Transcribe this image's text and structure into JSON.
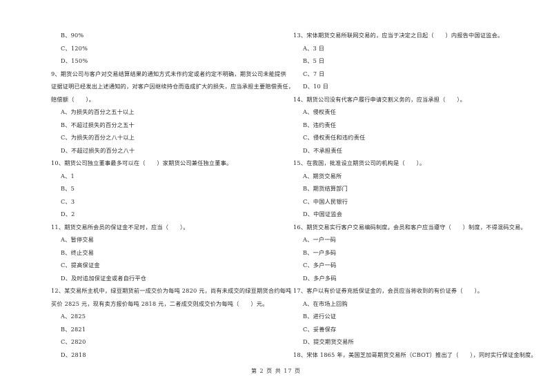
{
  "left_column": [
    {
      "type": "option",
      "text": "B、90%"
    },
    {
      "type": "option",
      "text": "C、120%"
    },
    {
      "type": "option",
      "text": "D、150%"
    },
    {
      "type": "question",
      "text": "9、期货公司与客户对交易结算结果的通知方式未作约定或者约定不明确，期货公司未能提供"
    },
    {
      "type": "question",
      "text": "证据证明已经发出上述通知的，对客户因继续持仓而造成扩大的损失，应当承担主要赔偿责任，"
    },
    {
      "type": "question",
      "text": "赔偿额（　　）。"
    },
    {
      "type": "option",
      "text": "A、为损失的百分之五十以上"
    },
    {
      "type": "option",
      "text": "B、不超过损失的百分之五十"
    },
    {
      "type": "option",
      "text": "C、为损失的百分之八十以上"
    },
    {
      "type": "option",
      "text": "D、不超过损失的百分之八十"
    },
    {
      "type": "question",
      "text": "10、期货公司独立董事最多可以在（　　）家期货公司兼任独立董事。"
    },
    {
      "type": "option",
      "text": "A、1"
    },
    {
      "type": "option",
      "text": "B、5"
    },
    {
      "type": "option",
      "text": "C、3"
    },
    {
      "type": "option",
      "text": "D、2"
    },
    {
      "type": "question",
      "text": "11、期货交易所会员的保证金不足时，应当（　　）。"
    },
    {
      "type": "option",
      "text": "A、暂停交易"
    },
    {
      "type": "option",
      "text": "B、终止交易"
    },
    {
      "type": "option",
      "text": "C、提高保证金"
    },
    {
      "type": "option",
      "text": "D、及时追加保证金或者自行平仓"
    },
    {
      "type": "question",
      "text": "12、某交易所主机中，绿豆期货前一成交价为每吨 2820 元，尚有未成交的绿豆期货合约每吨"
    },
    {
      "type": "question",
      "text": "买价 2825 元，现有卖方报价每吨 2818 元，二者成交则成交价为每吨（　　）元。"
    },
    {
      "type": "option",
      "text": "A、2825"
    },
    {
      "type": "option",
      "text": "B、2821"
    },
    {
      "type": "option",
      "text": "C、2820"
    },
    {
      "type": "option",
      "text": "D、2818"
    }
  ],
  "right_column": [
    {
      "type": "question",
      "text": "13、宋体期货交易所联网交易的，应当于决定之日起（　　）内报告中国证监会。"
    },
    {
      "type": "option",
      "text": "A、3 日"
    },
    {
      "type": "option",
      "text": "B、5 日"
    },
    {
      "type": "option",
      "text": "C、7 日"
    },
    {
      "type": "option",
      "text": "D、10 日"
    },
    {
      "type": "question",
      "text": "14、期货公司没有代客户履行申请交割义务的，应当承担（　　）。"
    },
    {
      "type": "option",
      "text": "A、侵权责任"
    },
    {
      "type": "option",
      "text": "B、违约责任"
    },
    {
      "type": "option",
      "text": "C、侵权责任和违约责任"
    },
    {
      "type": "option",
      "text": "D、不承担责任"
    },
    {
      "type": "question",
      "text": "15、在我国，批准设立期货公司的机构是（　　）。"
    },
    {
      "type": "option",
      "text": "A、期货交易所"
    },
    {
      "type": "option",
      "text": "B、期货结算部门"
    },
    {
      "type": "option",
      "text": "C、中国人民银行"
    },
    {
      "type": "option",
      "text": "D、中国证监会"
    },
    {
      "type": "question",
      "text": "16、期货交易实行客户交易编码制度。会员和客户应当遵守（　　）制度，不得混码交易。"
    },
    {
      "type": "option",
      "text": "A、一户一码"
    },
    {
      "type": "option",
      "text": "B、一户多码"
    },
    {
      "type": "option",
      "text": "C、多户一码"
    },
    {
      "type": "option",
      "text": "D、多户多码"
    },
    {
      "type": "question",
      "text": "17、客户以有价证券充抵保证金的，会员应当将收到的有价证券（　　）。"
    },
    {
      "type": "option",
      "text": "A、在市场上回购"
    },
    {
      "type": "option",
      "text": "B、进行公证"
    },
    {
      "type": "option",
      "text": "C、妥善保存"
    },
    {
      "type": "option",
      "text": "D、提交期货交易所"
    },
    {
      "type": "question",
      "text": "18、宋体 1865 年，美国芝加哥期货交易所（CBOT）推出了（　　），同时实行保证金制度。"
    }
  ],
  "footer": {
    "page_label": "第 2 页 共 17 页"
  }
}
